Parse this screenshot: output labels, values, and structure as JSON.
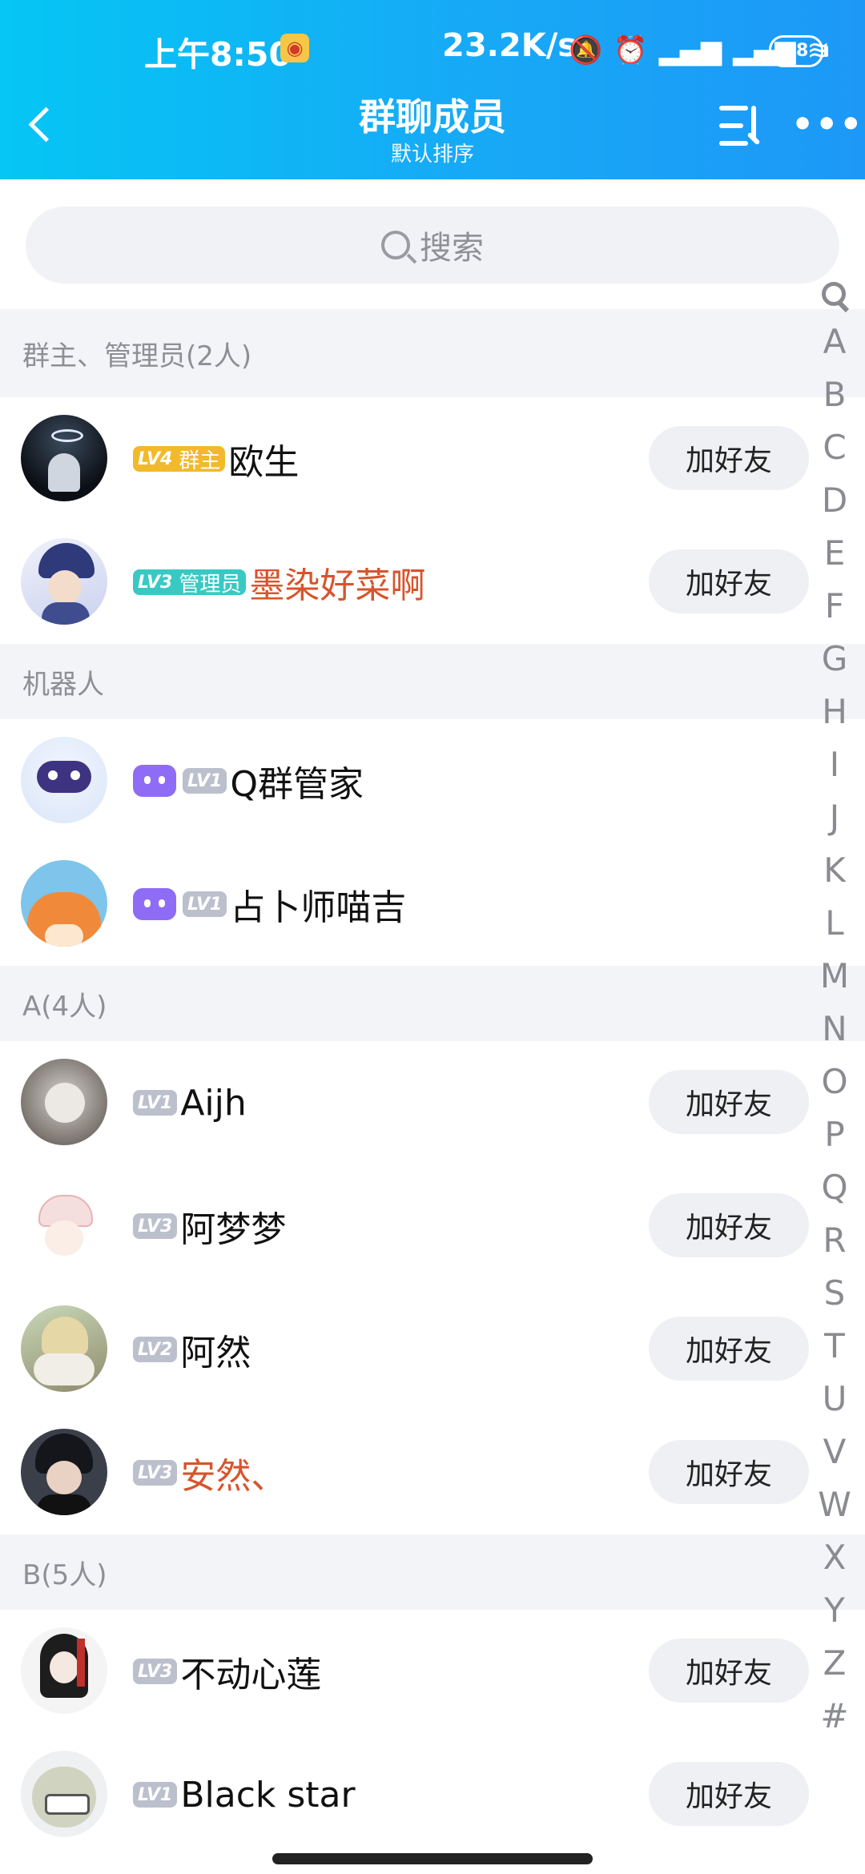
{
  "status": {
    "time": "上午8:50",
    "speed": "23.2K/s",
    "battery": "58"
  },
  "nav": {
    "title": "群聊成员",
    "subtitle": "默认排序"
  },
  "search": {
    "placeholder": "搜索"
  },
  "sections": [
    {
      "header": "群主、管理员(2人)",
      "members": [
        {
          "level": "LV4",
          "role": "群主",
          "badge_color": "#f2b92b",
          "name": "欧生",
          "add": "加好友"
        },
        {
          "level": "LV3",
          "role": "管理员",
          "badge_color": "#39c9c3",
          "name": "墨染好菜啊",
          "red": true,
          "add": "加好友"
        }
      ]
    },
    {
      "header": "机器人",
      "members": [
        {
          "robot": true,
          "level": "LV1",
          "name": "Q群管家"
        },
        {
          "robot": true,
          "level": "LV1",
          "name": "占卜师喵吉"
        }
      ]
    },
    {
      "header": "A(4人)",
      "members": [
        {
          "level": "LV1",
          "name": "Aijh",
          "add": "加好友"
        },
        {
          "level": "LV3",
          "name": "阿梦梦",
          "add": "加好友"
        },
        {
          "level": "LV2",
          "name": "阿然",
          "add": "加好友"
        },
        {
          "level": "LV3",
          "name": "安然、",
          "red": true,
          "add": "加好友"
        }
      ]
    },
    {
      "header": "B(5人)",
      "members": [
        {
          "level": "LV3",
          "name": "不动心莲",
          "add": "加好友"
        },
        {
          "level": "LV1",
          "name": "Black star",
          "add": "加好友"
        }
      ]
    }
  ],
  "index_letters": [
    "A",
    "B",
    "C",
    "D",
    "E",
    "F",
    "G",
    "H",
    "I",
    "J",
    "K",
    "L",
    "M",
    "N",
    "O",
    "P",
    "Q",
    "R",
    "S",
    "T",
    "U",
    "V",
    "W",
    "X",
    "Y",
    "Z",
    "#"
  ]
}
